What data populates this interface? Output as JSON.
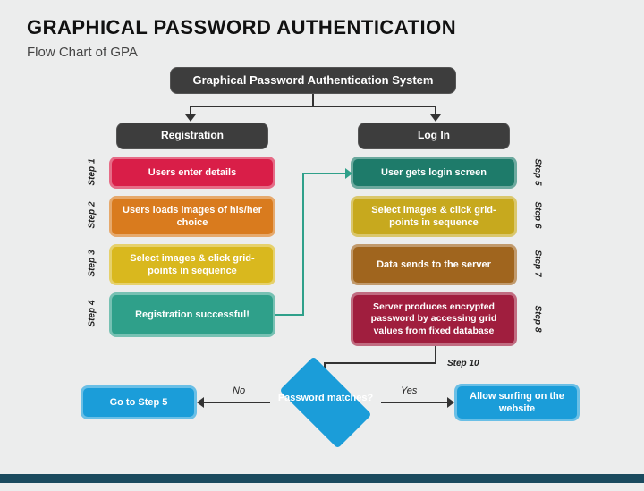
{
  "title": "GRAPHICAL PASSWORD AUTHENTICATION",
  "subtitle": "Flow Chart of GPA",
  "header": "Graphical Password Authentication System",
  "cols": {
    "reg": "Registration",
    "login": "Log In"
  },
  "steps": {
    "s1": "Users enter details",
    "s2": "Users loads images of his/her choice",
    "s3": "Select images & click grid-points in sequence",
    "s4": "Registration successful!",
    "s5": "User gets login screen",
    "s6": "Select images & click grid-points in sequence",
    "s7": "Data sends to the server",
    "s8": "Server produces encrypted password by accessing grid values from fixed database"
  },
  "labels": {
    "s1": "Step 1",
    "s2": "Step 2",
    "s3": "Step 3",
    "s4": "Step 4",
    "s5": "Step 5",
    "s6": "Step 6",
    "s7": "Step 7",
    "s8": "Step 8",
    "s10": "Step 10"
  },
  "decision": "Password matches?",
  "no": "No",
  "yes": "Yes",
  "nobox_pre": "Go to ",
  "nobox_bold": "Step 5",
  "yesbox": "Allow surfing on the website"
}
